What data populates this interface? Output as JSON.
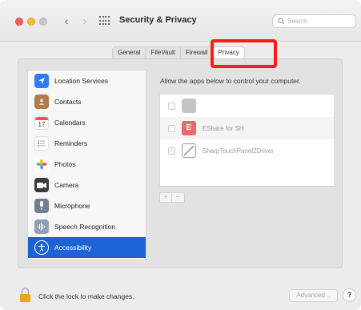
{
  "window": {
    "title": "Security & Privacy",
    "nav_back": "‹",
    "nav_forward": "›"
  },
  "search": {
    "placeholder": "Search"
  },
  "tabs": [
    {
      "label": "General",
      "active": false
    },
    {
      "label": "FileVault",
      "active": false
    },
    {
      "label": "Firewall",
      "active": false
    },
    {
      "label": "Privacy",
      "active": true
    }
  ],
  "sidebar": {
    "items": [
      {
        "label": "Location Services",
        "icon": "location-arrow-icon",
        "color": "#2f7cf6",
        "selected": false
      },
      {
        "label": "Contacts",
        "icon": "contacts-icon",
        "color": "#b07a4c",
        "selected": false
      },
      {
        "label": "Calendars",
        "icon": "calendar-icon",
        "color": "#ffffff",
        "selected": false,
        "glyph": "17"
      },
      {
        "label": "Reminders",
        "icon": "reminders-icon",
        "color": "#ffffff",
        "selected": false
      },
      {
        "label": "Photos",
        "icon": "photos-icon",
        "color": "#ffffff",
        "selected": false
      },
      {
        "label": "Camera",
        "icon": "camera-icon",
        "color": "#3a3a3a",
        "selected": false
      },
      {
        "label": "Microphone",
        "icon": "microphone-icon",
        "color": "#6f7f95",
        "selected": false
      },
      {
        "label": "Speech Recognition",
        "icon": "speech-waveform-icon",
        "color": "#8f9fb5",
        "selected": false
      },
      {
        "label": "Accessibility",
        "icon": "accessibility-icon",
        "color": "#1c64d6",
        "selected": true
      }
    ]
  },
  "main": {
    "instruction": "Allow the apps below to control your computer.",
    "apps": [
      {
        "name": "",
        "checked": false,
        "icon_color": "#c4c4c4"
      },
      {
        "name": "EShare for SH",
        "checked": false,
        "icon_color": "#ee6a6a",
        "glyph": "E"
      },
      {
        "name": "SharpTouchPanel2Driver",
        "checked": true,
        "icon_color": "#ffffff"
      }
    ],
    "add_label": "+",
    "remove_label": "−"
  },
  "footer": {
    "lock_text": "Click the lock to make changes.",
    "advanced_label": "Advanced...",
    "help_label": "?"
  },
  "colors": {
    "accent": "#1c64d6",
    "highlight_box": "#ff1a1a"
  }
}
